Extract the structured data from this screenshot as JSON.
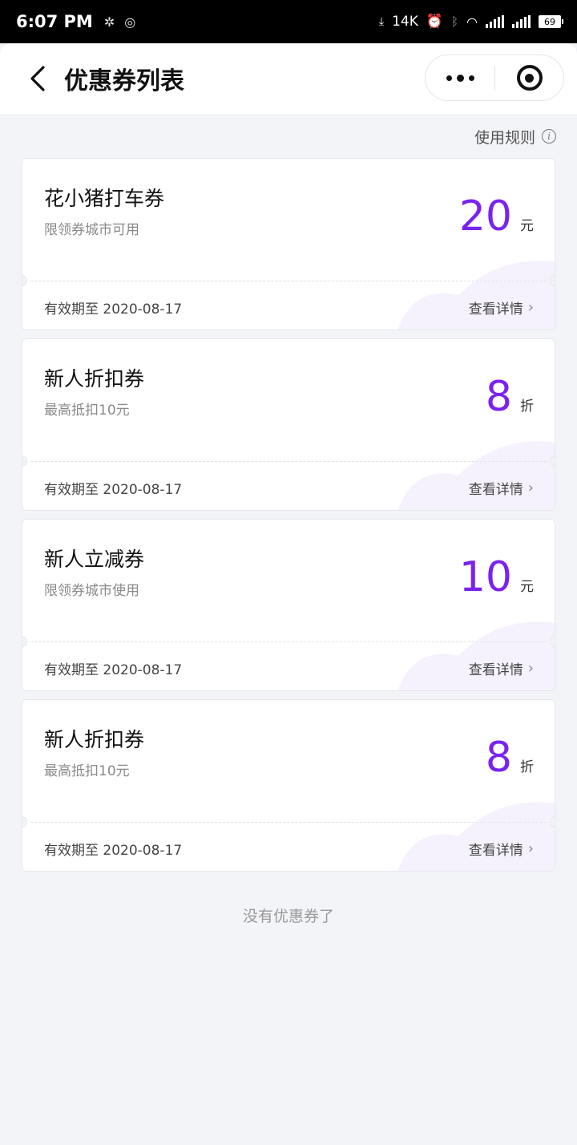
{
  "status": {
    "time": "6:07 PM",
    "net_speed": "14K",
    "battery": "69"
  },
  "header": {
    "title": "优惠券列表"
  },
  "rules_label": "使用规则",
  "coupons": [
    {
      "name": "花小猪打车券",
      "desc": "限领券城市可用",
      "amount": "20",
      "unit": "元",
      "expiry": "有效期至 2020-08-17",
      "detail": "查看详情"
    },
    {
      "name": "新人折扣券",
      "desc": "最高抵扣10元",
      "amount": "8",
      "unit": "折",
      "expiry": "有效期至 2020-08-17",
      "detail": "查看详情"
    },
    {
      "name": "新人立减券",
      "desc": "限领券城市使用",
      "amount": "10",
      "unit": "元",
      "expiry": "有效期至 2020-08-17",
      "detail": "查看详情"
    },
    {
      "name": "新人折扣券",
      "desc": "最高抵扣10元",
      "amount": "8",
      "unit": "折",
      "expiry": "有效期至 2020-08-17",
      "detail": "查看详情"
    }
  ],
  "end_note": "没有优惠券了",
  "colors": {
    "accent": "#7a22f0",
    "background": "#f3f4f8"
  }
}
